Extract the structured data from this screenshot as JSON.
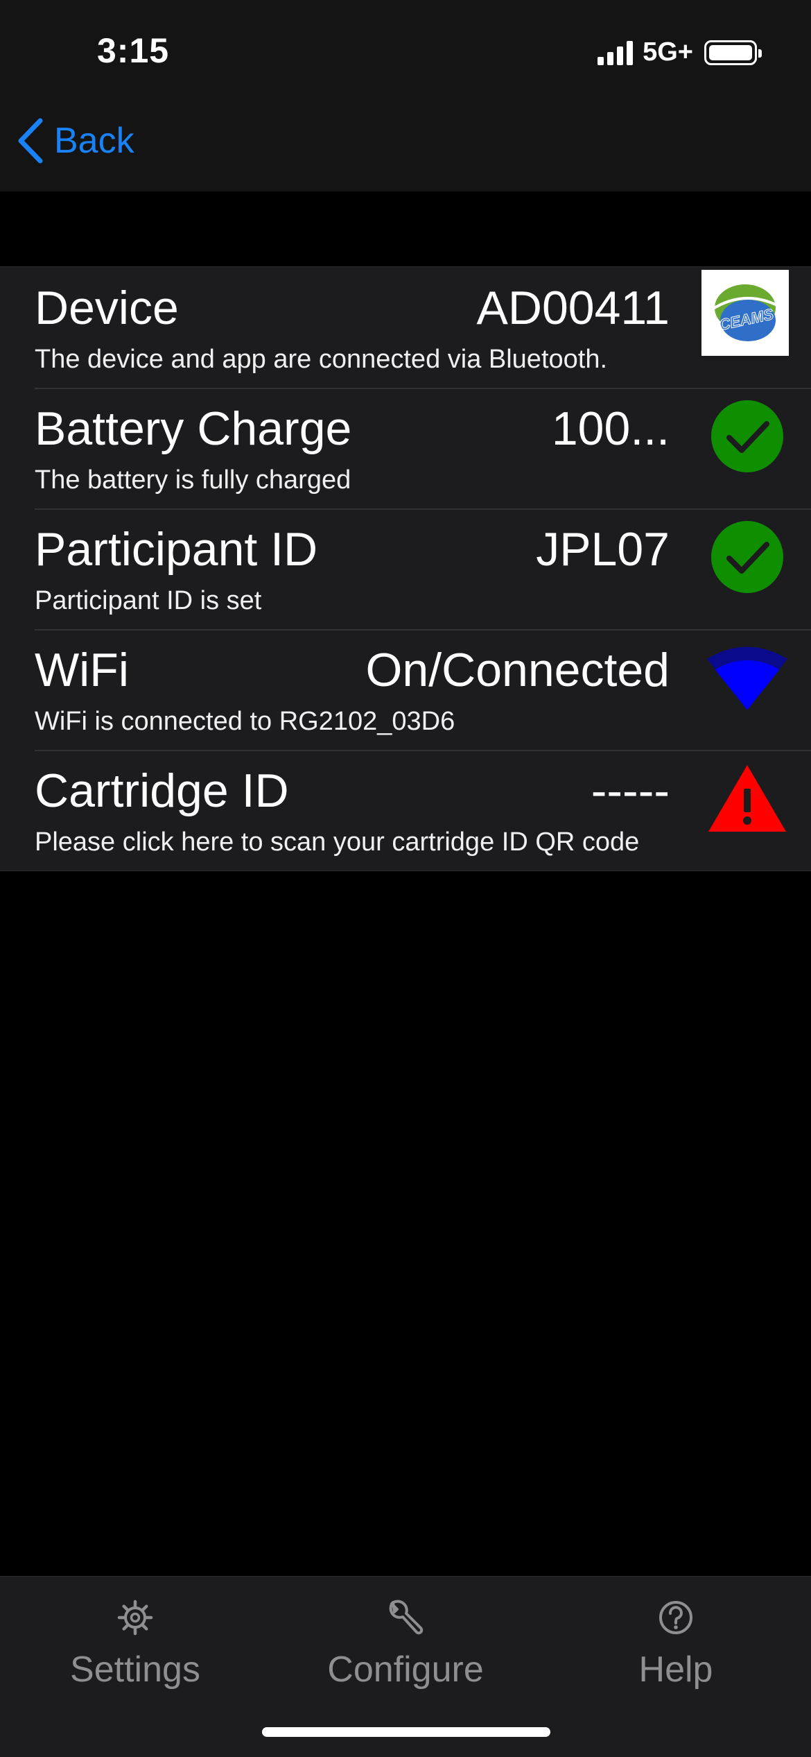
{
  "status_bar": {
    "time": "3:15",
    "network": "5G+",
    "battery_level": 1.0
  },
  "nav": {
    "back_label": "Back"
  },
  "rows": [
    {
      "title": "Device",
      "value": "AD00411",
      "subtitle": "The device and app are connected via Bluetooth.",
      "icon": "ceams-logo",
      "logo_text": "CEAMS"
    },
    {
      "title": "Battery Charge",
      "value": "100...",
      "subtitle": "The battery is fully charged",
      "icon": "check-circle-icon"
    },
    {
      "title": "Participant ID",
      "value": "JPL07",
      "subtitle": "Participant ID is set",
      "icon": "check-circle-icon"
    },
    {
      "title": "WiFi",
      "value": "On/Connected",
      "subtitle": "WiFi is connected to RG2102_03D6",
      "icon": "wifi-icon"
    },
    {
      "title": "Cartridge ID",
      "value": "-----",
      "subtitle": "Please click here to scan your cartridge ID QR code",
      "icon": "warning-icon"
    }
  ],
  "tabs": [
    {
      "label": "Settings",
      "icon": "gear-icon"
    },
    {
      "label": "Configure",
      "icon": "wrench-icon"
    },
    {
      "label": "Help",
      "icon": "help-circle-icon"
    }
  ],
  "colors": {
    "accent": "#1a82f7",
    "success": "#0f8f00",
    "wifi": "#0000ff",
    "warning": "#ff0000",
    "background": "#000000",
    "cell": "#1c1c1e",
    "tab_inactive": "#8e8e93"
  }
}
